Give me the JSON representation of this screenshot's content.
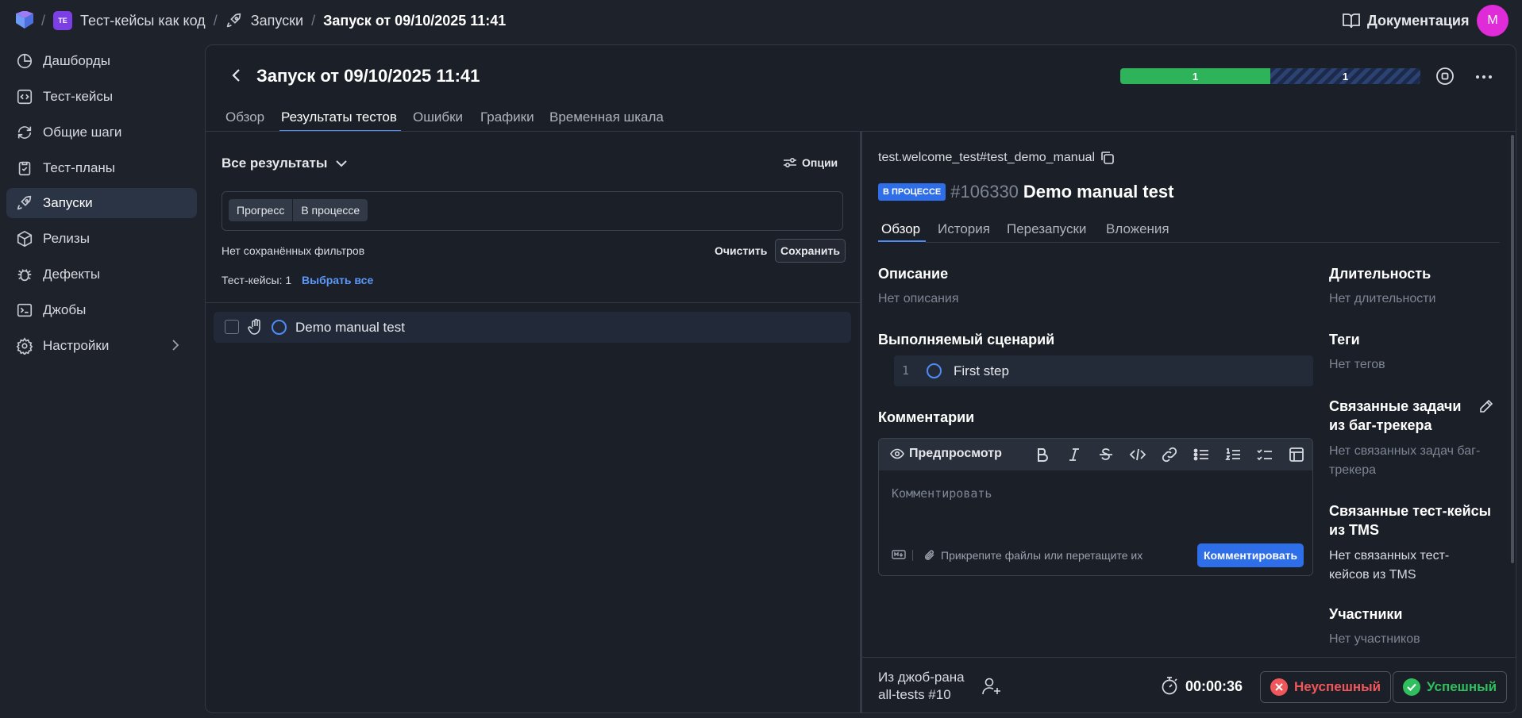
{
  "breadcrumb": {
    "project_badge": "TE",
    "project": "Тест-кейсы как код",
    "section": "Запуски",
    "current": "Запуск от 09/10/2025 11:41"
  },
  "header": {
    "docs": "Документация",
    "avatar": "M"
  },
  "sidebar": {
    "items": [
      {
        "label": "Дашборды",
        "icon": "dashboard-icon"
      },
      {
        "label": "Тест-кейсы",
        "icon": "code-icon"
      },
      {
        "label": "Общие шаги",
        "icon": "refresh-icon"
      },
      {
        "label": "Тест-планы",
        "icon": "clipboard-icon"
      },
      {
        "label": "Запуски",
        "icon": "rocket-icon",
        "active": true
      },
      {
        "label": "Релизы",
        "icon": "box-icon"
      },
      {
        "label": "Дефекты",
        "icon": "bug-icon"
      },
      {
        "label": "Джобы",
        "icon": "terminal-icon"
      },
      {
        "label": "Настройки",
        "icon": "gear-icon"
      }
    ]
  },
  "launch": {
    "title": "Запуск от 09/10/2025 11:41",
    "progress": {
      "passed": "1",
      "in_progress": "1",
      "passed_fraction": 0.5
    },
    "tabs": [
      "Обзор",
      "Результаты тестов",
      "Ошибки",
      "Графики",
      "Временная шкала"
    ],
    "active_tab": 1
  },
  "results": {
    "filter_title": "Все результаты",
    "options": "Опции",
    "chips": [
      "Прогресс",
      "В процессе"
    ],
    "no_filters": "Нет сохранённых фильтров",
    "clear": "Очистить",
    "save": "Сохранить",
    "count_label": "Тест-кейсы: 1",
    "select_all": "Выбрать все",
    "rows": [
      {
        "name": "Demo manual test"
      }
    ]
  },
  "detail": {
    "path": "test.welcome_test#test_demo_manual",
    "status": "В ПРОЦЕССЕ",
    "id": "#106330",
    "name": "Demo manual test",
    "tabs": [
      "Обзор",
      "История",
      "Перезапуски",
      "Вложения"
    ],
    "description_title": "Описание",
    "description_value": "Нет описания",
    "scenario_title": "Выполняемый сценарий",
    "steps": [
      {
        "num": "1",
        "text": "First step"
      }
    ],
    "comments_title": "Комментарии",
    "preview": "Предпросмотр",
    "comment_placeholder": "Комментировать",
    "attach": "Прикрепите файлы или перетащите их",
    "comment_button": "Комментировать",
    "duration_title": "Длительность",
    "duration_value": "Нет длительности",
    "tags_title": "Теги",
    "tags_value": "Нет тегов",
    "issues_title_1": "Связанные задачи",
    "issues_title_2": "из баг-трекера",
    "issues_value_1": "Нет связанных задач баг-",
    "issues_value_2": "трекера",
    "tms_title_1": "Связанные тест-кейсы",
    "tms_title_2": "из TMS",
    "tms_value_1": "Нет связанных тест-",
    "tms_value_2": "кейсов из TMS",
    "members_title": "Участники",
    "members_value": "Нет участников"
  },
  "footer": {
    "job_line1": "Из джоб-рана",
    "job_line2": "all-tests #10",
    "timer": "00:00:36",
    "fail": "Неуспешный",
    "pass": "Успешный"
  },
  "colors": {
    "accent": "#2e6ee8",
    "passed": "#2fb35a",
    "failed": "#f0575b",
    "badge": "#7b3fe4"
  }
}
